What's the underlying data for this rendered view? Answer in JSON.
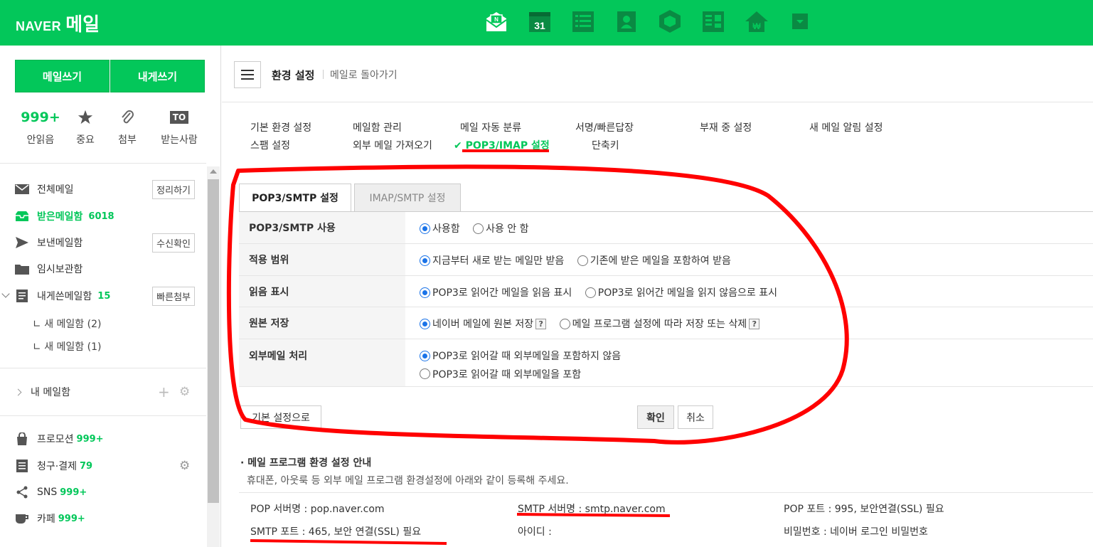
{
  "topbar": {
    "logo_naver": "NAVER",
    "logo_mail": "메일",
    "apps": [
      "mail-app-icon",
      "calendar-app-icon",
      "todo-app-icon",
      "contacts-app-icon",
      "mybox-app-icon",
      "memo-app-icon",
      "naverpay-app-icon",
      "more-apps-icon"
    ],
    "calendar_day": "31",
    "accent": "#03c75a"
  },
  "sidebar": {
    "write_mail": "메일쓰기",
    "write_self": "내게쓰기",
    "quick": [
      {
        "value": "999+",
        "label": "안읽음"
      },
      {
        "value": "",
        "label": "중요"
      },
      {
        "value": "",
        "label": "첨부"
      },
      {
        "value": "TO",
        "label": "받는사람"
      }
    ],
    "mailboxes": [
      {
        "label": "전체메일",
        "count": "",
        "button": "정리하기"
      },
      {
        "label": "받은메일함",
        "count": "6018",
        "button": ""
      },
      {
        "label": "보낸메일함",
        "count": "",
        "button": "수신확인"
      },
      {
        "label": "임시보관함",
        "count": "",
        "button": ""
      },
      {
        "label": "내게쓴메일함",
        "count": "15",
        "button": "빠른첨부"
      }
    ],
    "subfolders": [
      "새 메일함 (2)",
      "새 메일함 (1)"
    ],
    "my_mailbox": "내 메일함",
    "others": [
      {
        "label": "프로모션",
        "count": "999+"
      },
      {
        "label": "청구·결제",
        "count": "79"
      },
      {
        "label": "SNS",
        "count": "999+"
      },
      {
        "label": "카페",
        "count": "999+"
      }
    ]
  },
  "header": {
    "title": "환경 설정",
    "back": "메일로 돌아가기"
  },
  "settings_menu": [
    "기본 환경 설정",
    "메일함 관리",
    "메일 자동 분류",
    "서명/빠른답장",
    "부재 중 설정",
    "새 메일 알림 설정",
    "스팸 설정",
    "외부 메일 가져오기",
    "POP3/IMAP 설정",
    "단축키"
  ],
  "checkmark": "✔",
  "tabs": [
    "POP3/SMTP 설정",
    "IMAP/SMTP 설정"
  ],
  "rows": [
    {
      "label": "POP3/SMTP 사용",
      "options": [
        "사용함",
        "사용 안 함"
      ]
    },
    {
      "label": "적용 범위",
      "options": [
        "지금부터 새로 받는 메일만 받음",
        "기존에 받은 메일을 포함하여 받음"
      ]
    },
    {
      "label": "읽음 표시",
      "options": [
        "POP3로 읽어간 메일을 읽음 표시",
        "POP3로 읽어간 메일을 읽지 않음으로 표시"
      ]
    },
    {
      "label": "원본 저장",
      "options": [
        "네이버 메일에 원본 저장",
        "메일 프로그램 설정에 따라 저장 또는 삭제"
      ]
    },
    {
      "label": "외부메일 처리",
      "options": [
        "POP3로 읽어갈 때 외부메일을 포함하지 않음",
        "POP3로 읽어갈 때 외부메일을 포함"
      ]
    }
  ],
  "help_mark": "?",
  "buttons": {
    "reset": "기본 설정으로",
    "confirm": "확인",
    "cancel": "취소"
  },
  "guide": {
    "title": "메일 프로그램 환경 설정 안내",
    "desc": "휴대폰, 아웃룩 등 외부 메일 프로그램 환경설정에 아래와 같이 등록해 주세요.",
    "items": [
      "POP 서버명 : pop.naver.com",
      "SMTP 서버명 : smtp.naver.com",
      "POP 포트 : 995, 보안연결(SSL) 필요",
      "SMTP 포트 : 465, 보안 연결(SSL) 필요",
      "아이디 :",
      "비밀번호 : 네이버 로그인 비밀번호"
    ]
  },
  "annotation_color": "#ff0000"
}
